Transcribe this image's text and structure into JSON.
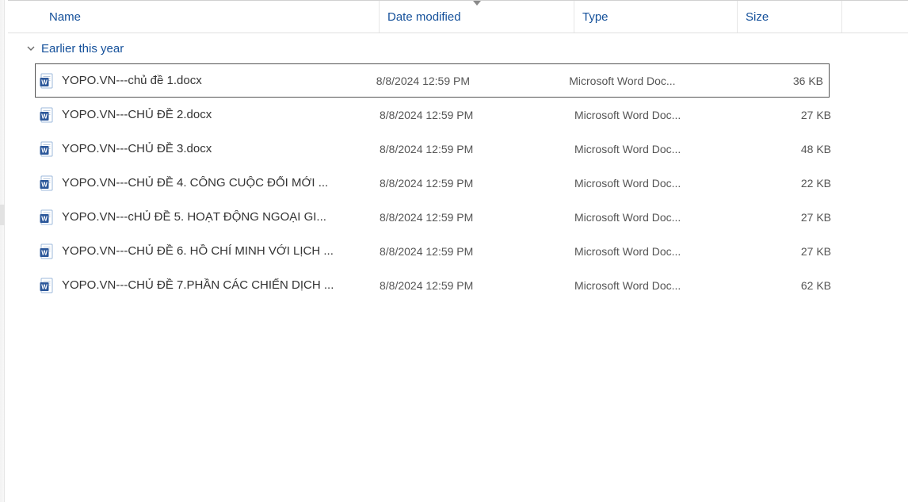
{
  "columns": {
    "name": "Name",
    "date": "Date modified",
    "type": "Type",
    "size": "Size"
  },
  "group": {
    "label": "Earlier this year"
  },
  "files": [
    {
      "name": "YOPO.VN---chủ đề 1.docx",
      "date": "8/8/2024 12:59 PM",
      "type": "Microsoft Word Doc...",
      "size": "36 KB",
      "selected": true
    },
    {
      "name": "YOPO.VN---CHỦ ĐỀ 2.docx",
      "date": "8/8/2024 12:59 PM",
      "type": "Microsoft Word Doc...",
      "size": "27 KB",
      "selected": false
    },
    {
      "name": "YOPO.VN---CHỦ ĐỀ 3.docx",
      "date": "8/8/2024 12:59 PM",
      "type": "Microsoft Word Doc...",
      "size": "48 KB",
      "selected": false
    },
    {
      "name": "YOPO.VN---CHỦ ĐỀ 4. CÔNG CUỘC ĐỔI MỚI ...",
      "date": "8/8/2024 12:59 PM",
      "type": "Microsoft Word Doc...",
      "size": "22 KB",
      "selected": false
    },
    {
      "name": "YOPO.VN---cHỦ ĐỀ 5. HOẠT ĐỘNG NGOẠI GI...",
      "date": "8/8/2024 12:59 PM",
      "type": "Microsoft Word Doc...",
      "size": "27 KB",
      "selected": false
    },
    {
      "name": "YOPO.VN---CHỦ ĐỀ 6. HỒ CHÍ MINH VỚI LỊCH ...",
      "date": "8/8/2024 12:59 PM",
      "type": "Microsoft Word Doc...",
      "size": "27 KB",
      "selected": false
    },
    {
      "name": "YOPO.VN---CHỦ ĐỀ 7.PHẦN CÁC CHIẾN DỊCH ...",
      "date": "8/8/2024 12:59 PM",
      "type": "Microsoft Word Doc...",
      "size": "62 KB",
      "selected": false
    }
  ]
}
